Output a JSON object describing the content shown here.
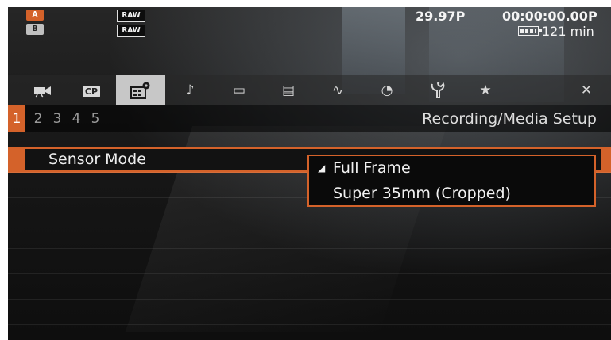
{
  "status": {
    "icon_a_label": "A",
    "icon_b_label": "B",
    "raw_1": "RAW",
    "raw_2": "RAW",
    "frame_rate": "29.97P",
    "timecode": "00:00:00.00P",
    "remaining_time": "121 min"
  },
  "tabs": [
    {
      "name": "camera-tab",
      "icon": "movie-camera-icon",
      "glyph": "📹"
    },
    {
      "name": "cp-tab",
      "icon": "custom-picture-icon",
      "glyph": "CP"
    },
    {
      "name": "recording-media-setup-tab",
      "icon": "film-gear-icon",
      "glyph": "🎞"
    },
    {
      "name": "audio-setup-tab",
      "icon": "audio-icon",
      "glyph": "♪"
    },
    {
      "name": "monitoring-setup-tab",
      "icon": "monitor-icon",
      "glyph": "▭"
    },
    {
      "name": "assistance-functions-tab",
      "icon": "waveform-icon",
      "glyph": "▤"
    },
    {
      "name": "network-tab",
      "icon": "network-icon",
      "glyph": "∿"
    },
    {
      "name": "tc-tab",
      "icon": "tc-icon",
      "glyph": "◔"
    },
    {
      "name": "system-setup-tab",
      "icon": "wrench-icon",
      "glyph": "🔧"
    },
    {
      "name": "my-menu-tab",
      "icon": "star-icon",
      "glyph": "★"
    },
    {
      "name": "close-tab",
      "icon": "close-icon",
      "glyph": "✕"
    }
  ],
  "pages": [
    "1",
    "2",
    "3",
    "4",
    "5"
  ],
  "menu_title": "Recording/Media Setup",
  "rows": [
    {
      "label": "Sensor Mode"
    }
  ],
  "options": {
    "items": [
      "Full Frame",
      "Super 35mm (Cropped)"
    ],
    "selected_index": 0
  },
  "colors": {
    "accent": "#d4622a",
    "active_tab": "#c7c7c7"
  }
}
